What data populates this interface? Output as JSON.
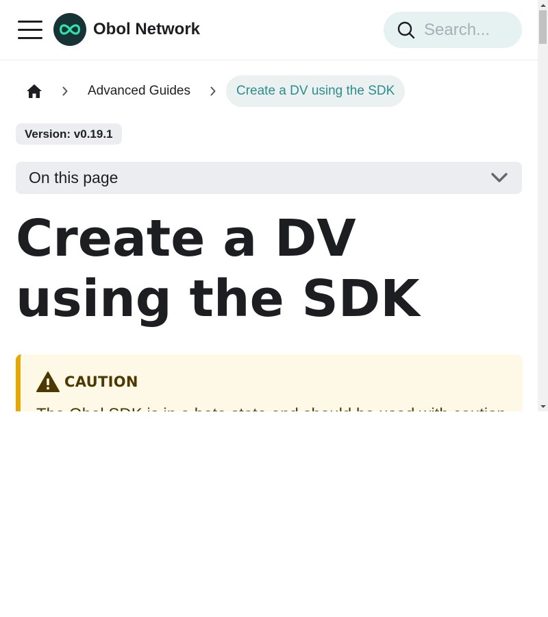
{
  "colors": {
    "accent": "#2c8c8c",
    "logo_bg": "#173335",
    "logo_mark": "#2fe4ab",
    "search_bg": "#e6f1f1",
    "caution_bg": "#fef8e7",
    "caution_border": "#e6a700",
    "caution_text": "#4d3800"
  },
  "navbar": {
    "menu_icon": "hamburger-icon",
    "logo_icon": "infinity-logo-icon",
    "brand": "Obol Network",
    "search": {
      "icon": "search-icon",
      "placeholder": "Search..."
    }
  },
  "breadcrumbs": {
    "home_icon": "home-icon",
    "separator_icon": "chevron-right-icon",
    "items": [
      {
        "label": "Advanced Guides"
      },
      {
        "label": "Create a DV using the SDK",
        "active": true
      }
    ]
  },
  "version_badge": "Version: v0.19.1",
  "toc": {
    "label": "On this page",
    "icon": "chevron-down-icon"
  },
  "title": "Create a DV using the SDK",
  "caution": {
    "icon": "warning-icon",
    "title": "CAUTION",
    "body": "The Obol SDK is in a beta state and should be used with caution"
  }
}
